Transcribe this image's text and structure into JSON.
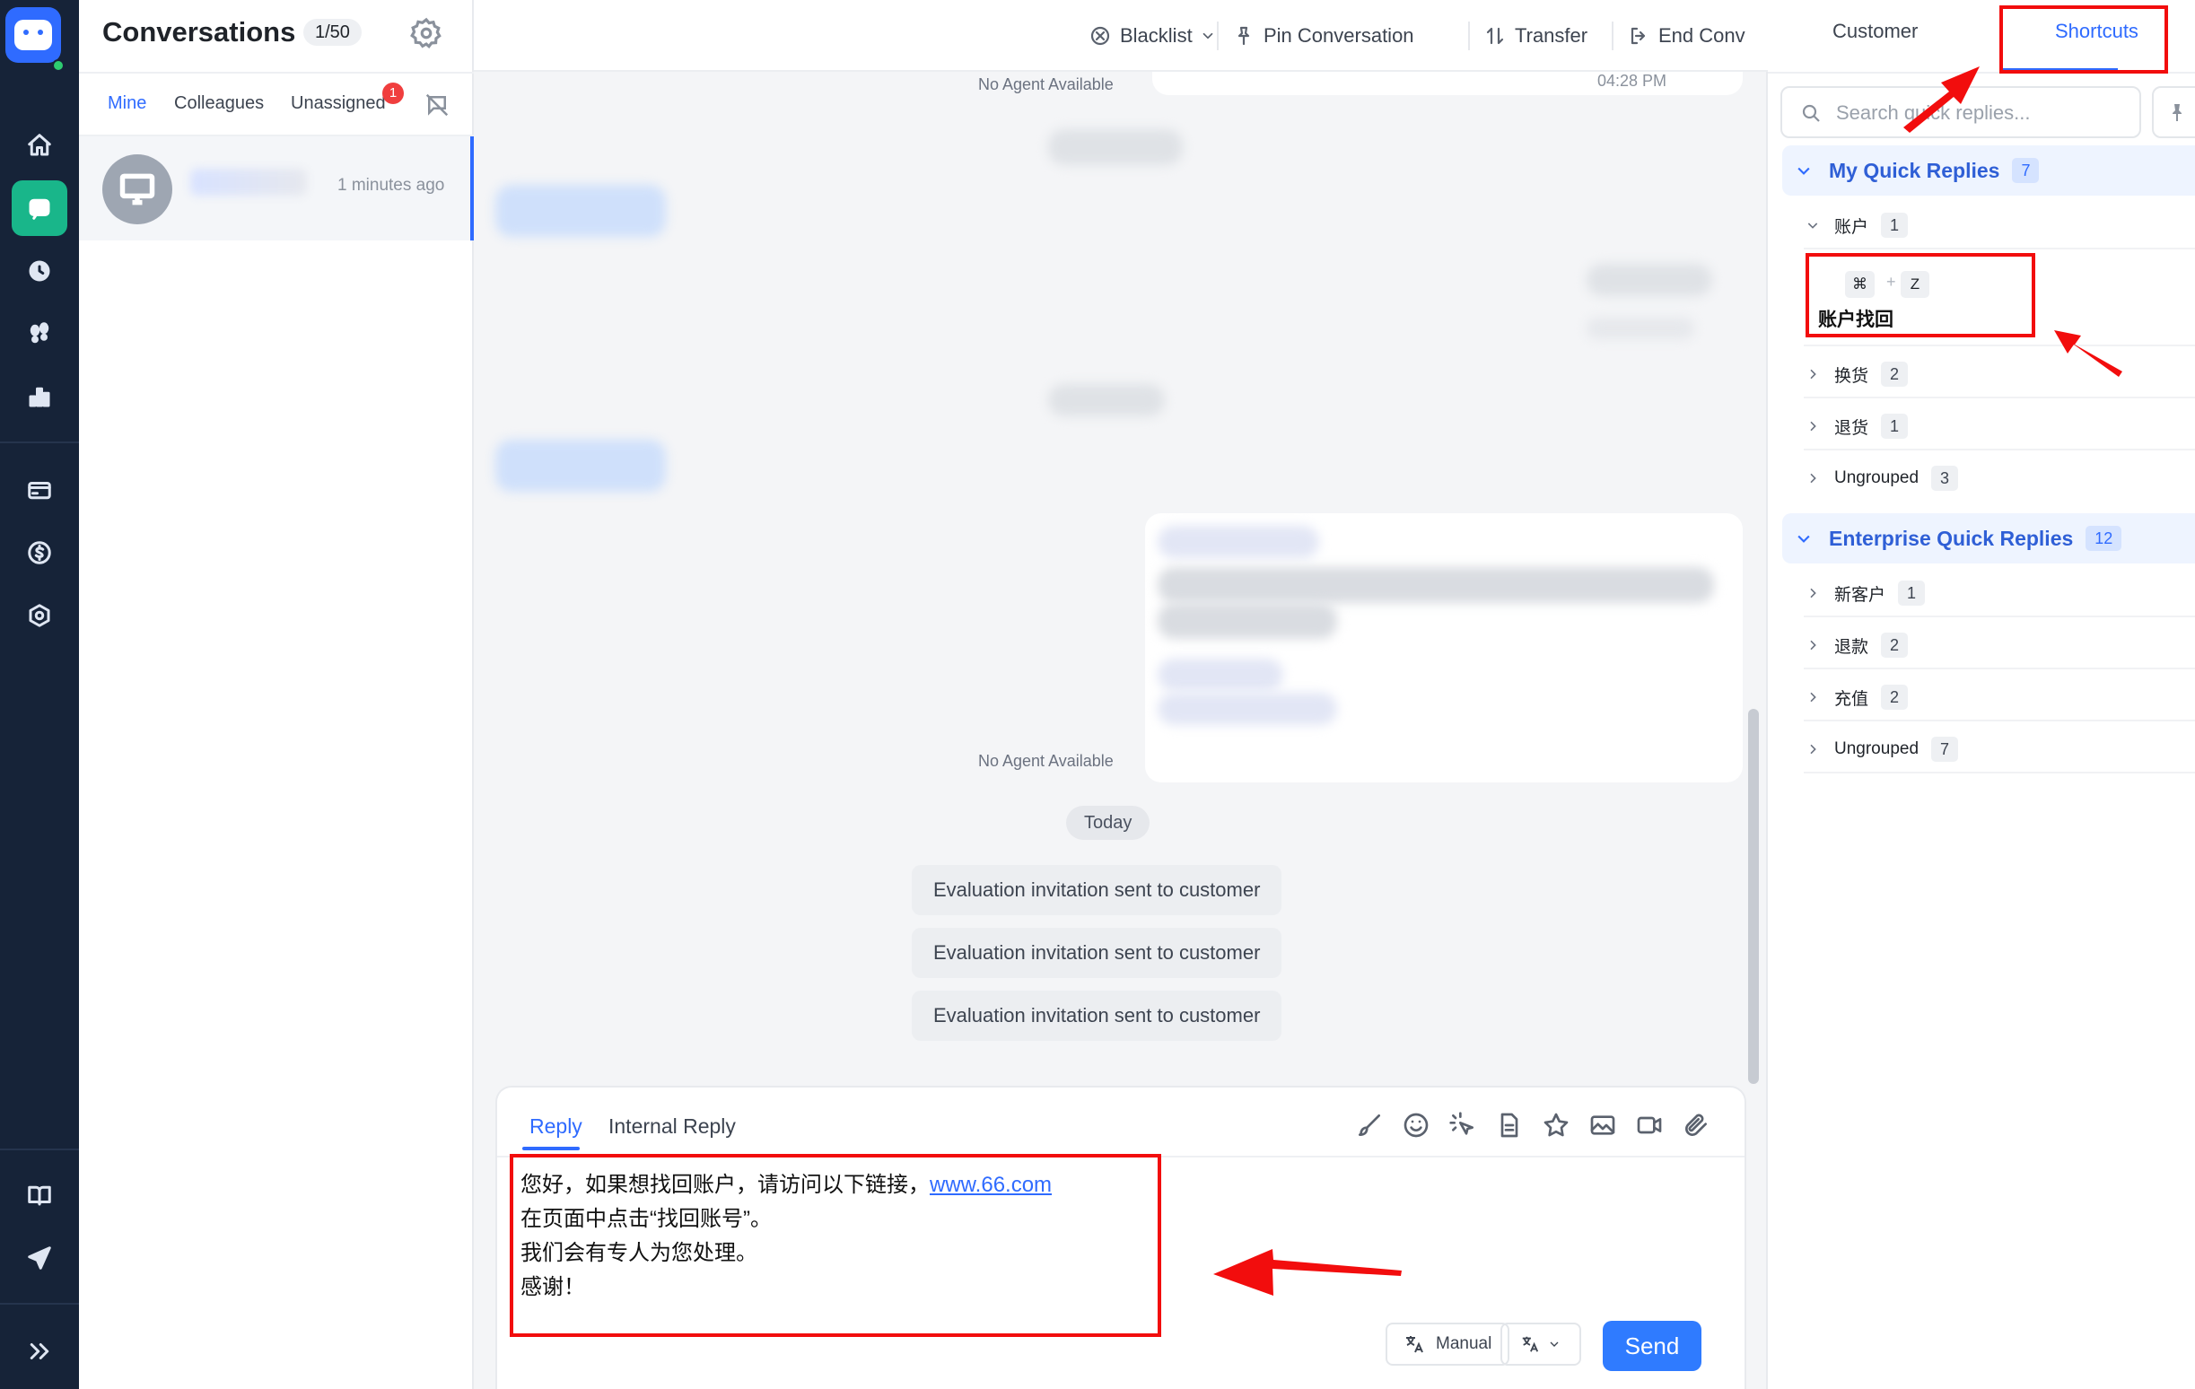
{
  "rail": {
    "items": [
      "home-icon",
      "chat-icon",
      "history-icon",
      "footprints-icon",
      "stats-icon",
      "card-icon",
      "dollar-icon",
      "settings-hex-icon",
      "book-icon",
      "send-icon",
      "expand-icon"
    ],
    "active": "chat-icon",
    "colors": {
      "background": "#162338",
      "active": "#19b68a",
      "brand": "#2f6bff"
    }
  },
  "conversations": {
    "title": "Conversations",
    "count": "1/50",
    "tabs": [
      "Mine",
      "Colleagues",
      "Unassigned"
    ],
    "unassigned_badge": "1",
    "list": [
      {
        "time": "1 minutes ago"
      }
    ]
  },
  "chat": {
    "toolbar": {
      "blacklist": "Blacklist",
      "pin": "Pin Conversation",
      "transfer": "Transfer",
      "end": "End Conv"
    },
    "messages": {
      "top_status": "No Agent Available",
      "top_time": "04:28 PM",
      "card_status": "No Agent Available",
      "day_divider": "Today",
      "events": [
        "Evaluation invitation sent to customer",
        "Evaluation invitation sent to customer",
        "Evaluation invitation sent to customer"
      ]
    },
    "composer": {
      "tabs": [
        "Reply",
        "Internal Reply"
      ],
      "tools": [
        "brush-icon",
        "emoji-icon",
        "magic-pointer-icon",
        "document-icon",
        "star-icon",
        "image-icon",
        "video-icon",
        "attachment-icon"
      ],
      "lines": [
        "您好，如果想找回账户，请访问以下链接，",
        "在页面中点击“找回账号”。",
        "我们会有专人为您处理。",
        "感谢！"
      ],
      "link": "www.66.com",
      "manual_label": "Manual",
      "send_label": "Send"
    }
  },
  "right_panel": {
    "tabs": [
      "Customer",
      "Shortcuts"
    ],
    "active_tab": "Shortcuts",
    "search_placeholder": "Search quick replies...",
    "groups": [
      {
        "name": "My Quick Replies",
        "count": "7",
        "expanded": true,
        "folders": [
          {
            "name": "账户",
            "count": "1",
            "expanded": true,
            "replies": [
              {
                "keys": [
                  "⌘",
                  "Z"
                ],
                "title": "账户找回"
              }
            ]
          },
          {
            "name": "换货",
            "count": "2"
          },
          {
            "name": "退货",
            "count": "1"
          },
          {
            "name": "Ungrouped",
            "count": "3"
          }
        ]
      },
      {
        "name": "Enterprise Quick Replies",
        "count": "12",
        "expanded": true,
        "folders": [
          {
            "name": "新客户",
            "count": "1"
          },
          {
            "name": "退款",
            "count": "2"
          },
          {
            "name": "充值",
            "count": "2"
          },
          {
            "name": "Ungrouped",
            "count": "7"
          }
        ]
      }
    ]
  },
  "annotation_color": "#f20d0d"
}
